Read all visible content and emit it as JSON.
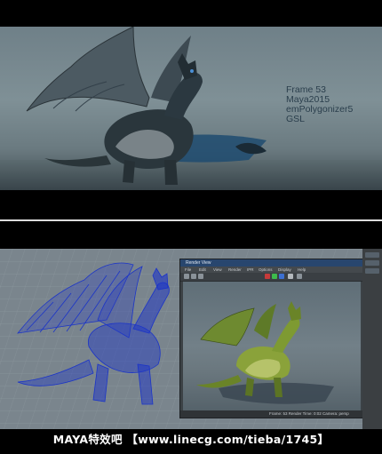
{
  "render_overlay": {
    "lines": [
      "Frame 53",
      "Maya2015",
      "emPolygonizer5",
      "GSL"
    ]
  },
  "render_window": {
    "title": "Render View",
    "menus": [
      "File",
      "Edit",
      "View",
      "Render",
      "IPR",
      "Options",
      "Display",
      "Help"
    ],
    "status": "Frame: 53   Render Time: 0:02   Camera: persp"
  },
  "watermark": {
    "text": "MAYA特效吧 【www.linecg.com/tieba/1745】"
  },
  "colors": {
    "dragon_render": "#1e2a30",
    "wireframe": "#1b34c8",
    "dragon_green": "#8aa23a"
  }
}
